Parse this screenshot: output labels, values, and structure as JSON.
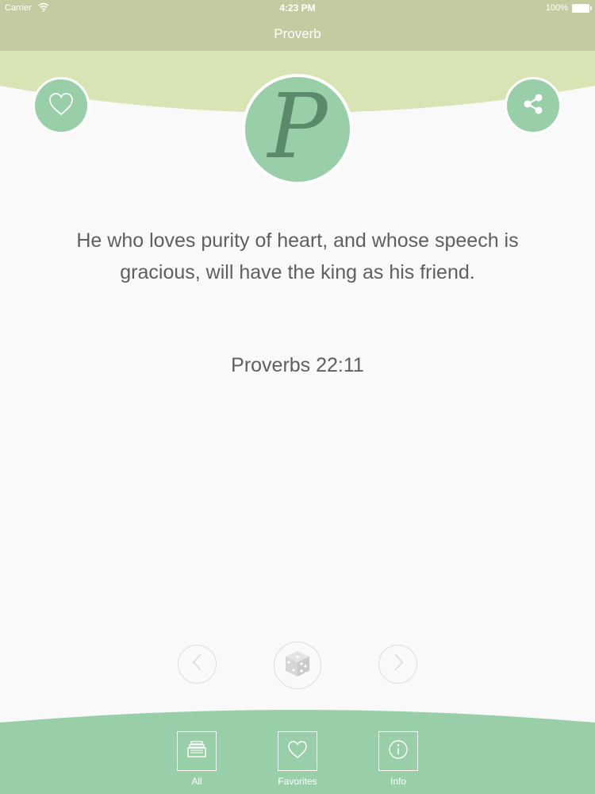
{
  "status_bar": {
    "carrier": "Carrier",
    "time": "4:23 PM",
    "battery": "100%"
  },
  "nav": {
    "title": "Proverb"
  },
  "logo": {
    "letter": "P"
  },
  "proverb": {
    "text": "He who loves purity of heart, and whose speech is gracious, will have the king as his friend.",
    "reference": "Proverbs 22:11"
  },
  "tabs": [
    {
      "label": "All",
      "icon": "books-icon"
    },
    {
      "label": "Favorites",
      "icon": "heart-icon"
    },
    {
      "label": "Info",
      "icon": "info-icon"
    }
  ],
  "controls": {
    "prev_icon": "chevron-left-icon",
    "random_icon": "dice-icon",
    "next_icon": "chevron-right-icon"
  },
  "colors": {
    "header": "#c2cca0",
    "header_wave": "#d8e4b4",
    "accent_green": "#98cfa9",
    "logo_letter": "#5a8a6b",
    "text": "#5f5f5f",
    "background": "#f9f9f9"
  }
}
